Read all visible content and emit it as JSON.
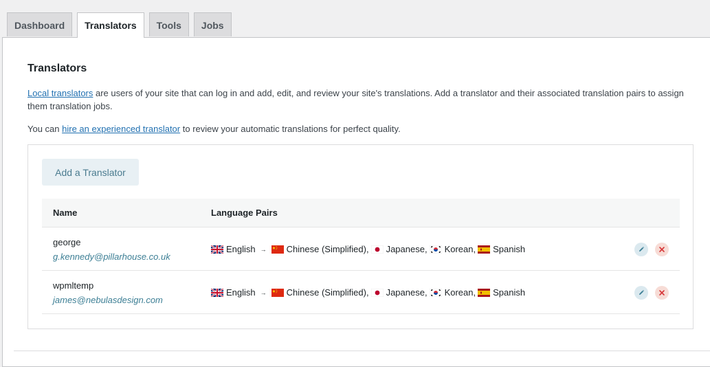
{
  "tabs": [
    {
      "label": "Dashboard",
      "active": false
    },
    {
      "label": "Translators",
      "active": true
    },
    {
      "label": "Tools",
      "active": false
    },
    {
      "label": "Jobs",
      "active": false
    }
  ],
  "section": {
    "title": "Translators",
    "intro_link": "Local translators",
    "intro_text": " are users of your site that can log in and add, edit, and review your site's translations. Add a translator and their associated translation pairs to assign them translation jobs.",
    "hire_prefix": "You can ",
    "hire_link": "hire an experienced translator",
    "hire_suffix": " to review your automatic translations for perfect quality."
  },
  "add_button": "Add a Translator",
  "table": {
    "columns": [
      "Name",
      "Language Pairs"
    ],
    "arrow": "→",
    "rows": [
      {
        "name": "george",
        "email": "g.kennedy@pillarhouse.co.uk",
        "source": {
          "flag": "uk-flag",
          "lang": "English"
        },
        "targets": [
          {
            "flag": "china-flag",
            "lang": "Chinese (Simplified),"
          },
          {
            "flag": "japan-flag",
            "lang": "Japanese,"
          },
          {
            "flag": "korea-flag",
            "lang": "Korean,"
          },
          {
            "flag": "spain-flag",
            "lang": "Spanish"
          }
        ]
      },
      {
        "name": "wpmltemp",
        "email": "james@nebulasdesign.com",
        "source": {
          "flag": "uk-flag",
          "lang": "English"
        },
        "targets": [
          {
            "flag": "china-flag",
            "lang": "Chinese (Simplified),"
          },
          {
            "flag": "japan-flag",
            "lang": "Japanese,"
          },
          {
            "flag": "korea-flag",
            "lang": "Korean,"
          },
          {
            "flag": "spain-flag",
            "lang": "Spanish"
          }
        ]
      }
    ]
  },
  "icons": {
    "edit": "pencil-icon",
    "delete": "close-icon"
  },
  "colors": {
    "link": "#2271b1",
    "edit_bg": "#dbe9ef",
    "delete_bg": "#f7dcd6",
    "delete_icon": "#d63638",
    "edit_icon": "#3d7f95"
  }
}
